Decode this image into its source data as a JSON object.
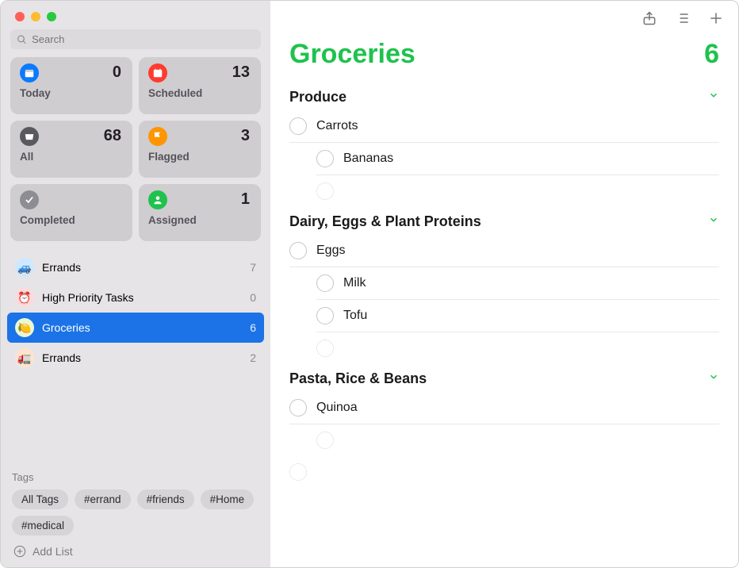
{
  "search": {
    "placeholder": "Search"
  },
  "smart": [
    {
      "key": "today",
      "label": "Today",
      "count": 0,
      "bg": "#0a7aff"
    },
    {
      "key": "scheduled",
      "label": "Scheduled",
      "count": 13,
      "bg": "#ff3b30"
    },
    {
      "key": "all",
      "label": "All",
      "count": 68,
      "bg": "#5a595e"
    },
    {
      "key": "flagged",
      "label": "Flagged",
      "count": 3,
      "bg": "#ff9500"
    },
    {
      "key": "completed",
      "label": "Completed",
      "count": "",
      "bg": "#8e8d93"
    },
    {
      "key": "assigned",
      "label": "Assigned",
      "count": 1,
      "bg": "#1fc24d"
    }
  ],
  "lists": [
    {
      "name": "Errands",
      "count": 7,
      "emoji": "🚙",
      "bg": "#cde8ff",
      "selected": false
    },
    {
      "name": "High Priority Tasks",
      "count": 0,
      "emoji": "⏰",
      "bg": "#ffd9dc",
      "selected": false
    },
    {
      "name": "Groceries",
      "count": 6,
      "emoji": "🍋",
      "bg": "#eaf7d5",
      "selected": true
    },
    {
      "name": "Errands",
      "count": 2,
      "emoji": "🚛",
      "bg": "#ffe3cf",
      "selected": false
    }
  ],
  "tags_header": "Tags",
  "tags": [
    "All Tags",
    "#errand",
    "#friends",
    "#Home",
    "#medical"
  ],
  "add_list_label": "Add List",
  "main": {
    "title": "Groceries",
    "count": 6,
    "sections": [
      {
        "title": "Produce",
        "items": [
          "Carrots",
          "Bananas"
        ]
      },
      {
        "title": "Dairy, Eggs & Plant Proteins",
        "items": [
          "Eggs",
          "Milk",
          "Tofu"
        ]
      },
      {
        "title": "Pasta, Rice & Beans",
        "items": [
          "Quinoa"
        ]
      }
    ]
  }
}
